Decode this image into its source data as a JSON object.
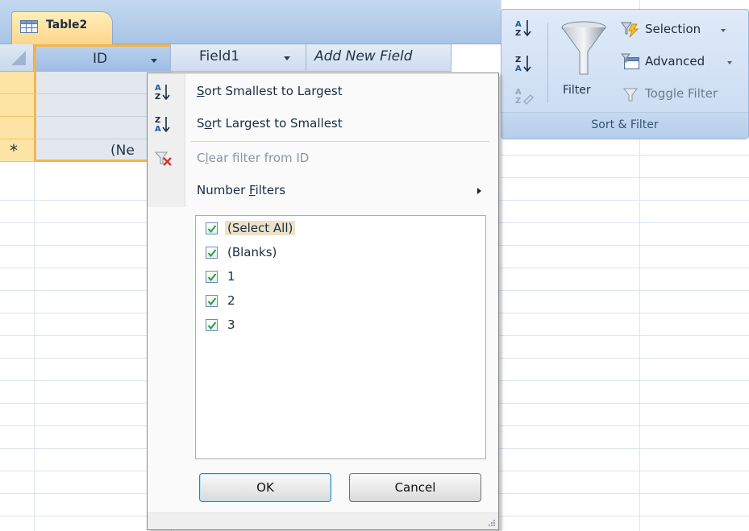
{
  "object_tab": {
    "icon": "table-icon",
    "label": "Table2"
  },
  "datasheet": {
    "columns": [
      {
        "label": "ID"
      },
      {
        "label": "Field1"
      },
      {
        "label": "Add New Field"
      }
    ],
    "new_record_marker": "*",
    "new_record_text": "(Ne"
  },
  "ribbon": {
    "group_name": "Sort & Filter",
    "sort_ascending_icon": "sort-ascending-icon",
    "sort_descending_icon": "sort-descending-icon",
    "clear_sort_icon": "clear-sort-icon",
    "filter_label": "Filter",
    "selection_label": "Selection",
    "advanced_label": "Advanced",
    "toggle_filter_label": "Toggle Filter"
  },
  "filter_menu": {
    "items": [
      {
        "icon": "sort-ascending-icon",
        "label": "Sort Smallest to Largest",
        "accel_index": 0,
        "enabled": true
      },
      {
        "icon": "sort-descending-icon",
        "label": "Sort Largest to Smallest",
        "accel_index": 1,
        "enabled": true
      },
      {
        "icon": "clear-filter-icon",
        "label": "Clear filter from ID",
        "accel_index": 1,
        "enabled": false
      },
      {
        "icon": "",
        "label": "Number Filters",
        "accel_index": 7,
        "enabled": true,
        "submenu": true
      }
    ],
    "checklist": [
      {
        "label": "(Select All)",
        "checked": true
      },
      {
        "label": "(Blanks)",
        "checked": true
      },
      {
        "label": "1",
        "checked": true
      },
      {
        "label": "2",
        "checked": true
      },
      {
        "label": "3",
        "checked": true
      }
    ],
    "ok_label": "OK",
    "cancel_label": "Cancel"
  },
  "colors": {
    "selected_column_accent": "#f0b64d",
    "ribbon_bg": "#dfeaf8",
    "tab_bg": "#fcd58c"
  }
}
